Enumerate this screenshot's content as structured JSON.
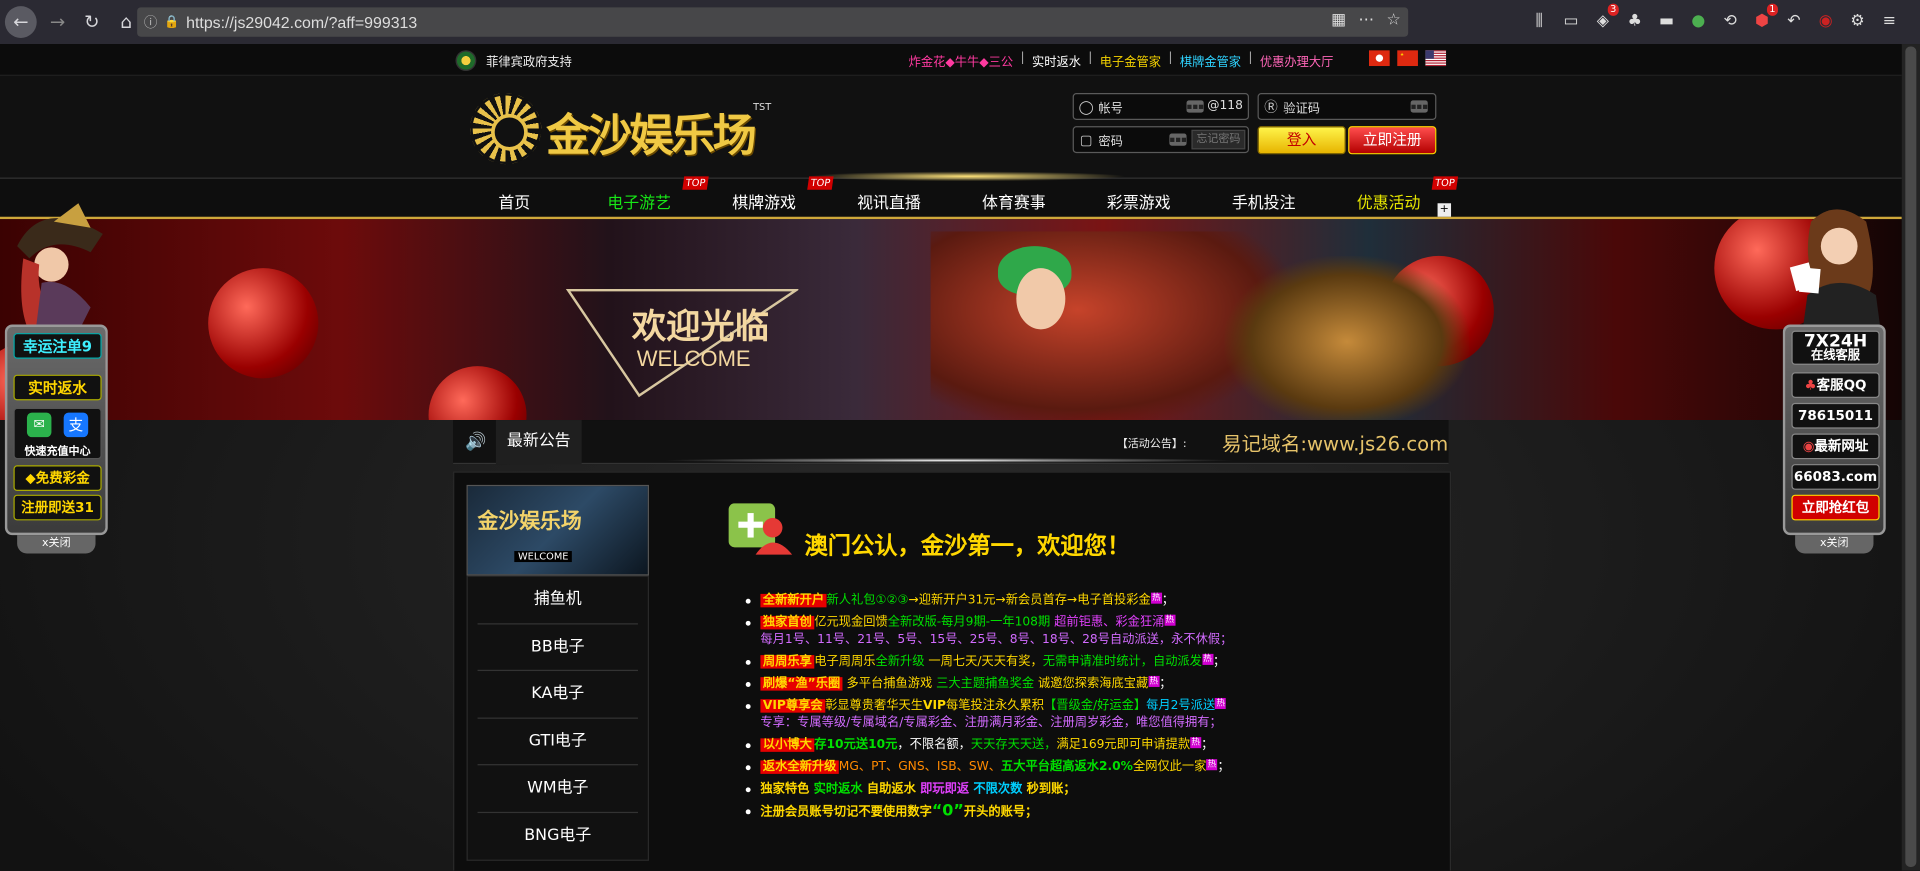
{
  "browser": {
    "url": "https://js29042.com/?aff=999313",
    "badges": {
      "ext1": "3",
      "ext2": "1"
    }
  },
  "topbar": {
    "gov_text": "菲律宾政府支持",
    "links": [
      {
        "label": "炸金花◆牛牛◆三公",
        "color": "#ff3aa0"
      },
      {
        "label": "实时返水",
        "color": "#ffffff"
      },
      {
        "label": "电子金管家",
        "color": "#f5d300"
      },
      {
        "label": "棋牌金管家",
        "color": "#2fd3ff"
      },
      {
        "label": "优惠办理大厅",
        "color": "#ff66b8"
      }
    ]
  },
  "logo": {
    "name": "金沙娱乐场",
    "tst": "TST"
  },
  "login": {
    "user_placeholder": "帐号",
    "user_suffix": "@118",
    "pass_placeholder": "密码",
    "remember": "忘记密码",
    "captcha_placeholder": "验证码",
    "login_btn": "登入",
    "register_btn": "立即注册"
  },
  "nav": {
    "items": [
      {
        "label": "首页",
        "color": "#ffffff"
      },
      {
        "label": "电子游艺",
        "color": "#17e617"
      },
      {
        "label": "棋牌游戏",
        "color": "#ffffff"
      },
      {
        "label": "视讯直播",
        "color": "#ffffff"
      },
      {
        "label": "体育赛事",
        "color": "#ffffff"
      },
      {
        "label": "彩票游戏",
        "color": "#ffffff"
      },
      {
        "label": "手机投注",
        "color": "#ffffff"
      },
      {
        "label": "优惠活动",
        "color": "#e6e600"
      }
    ],
    "tag": "TOP",
    "plus": "+"
  },
  "banner": {
    "cn": "欢迎光临",
    "en": "WELCOME"
  },
  "notice": {
    "title": "最新公告",
    "activity": "【活动公告】:",
    "domain": "易记域名:www.js26.com"
  },
  "side": {
    "img_title": "金沙娱乐场",
    "img_welcome": "WELCOME",
    "menu": [
      "捕鱼机",
      "BB电子",
      "KA电子",
      "GTI电子",
      "WM电子",
      "BNG电子"
    ]
  },
  "main": {
    "headline": "澳门公认，金沙第一，欢迎您！",
    "hot": "热",
    "items": {
      "i1": {
        "tag": "全新新开户",
        "a": "新人礼包①②③",
        "b": "→迎新开户31元→新会员首存→电子首投彩金",
        "end": "；"
      },
      "i2": {
        "tag": "独家首创",
        "a": "亿元现金回馈",
        "b": "全新改版-每月9期-一年108期",
        "c": " 超前钜惠、彩金狂涌",
        "sub": "每月1号、11号、21号、5号、15号、25号、8号、18号、28号自动派送，永不休假；"
      },
      "i3": {
        "tag": "周周乐享",
        "a": "电子周周乐",
        "b": "全新升级",
        "c": " 一周七天/天天有奖，",
        "d": "无需申请准时统计，自动派发",
        "end": "；"
      },
      "i4": {
        "tag": "刷爆“渔”乐圈",
        "a": " 多平台捕鱼游戏 ",
        "b": " 三大主题捕鱼奖金 ",
        "c": " 诚邀您探索海底宝藏",
        "end": "；"
      },
      "i5": {
        "tag": "VIP尊享会",
        "a": "彰显尊贵奢华天生",
        "b": "VIP",
        "c": "每笔投注永久累积",
        "d": "【晋级金/好运金】",
        "e": "每月2号派送",
        "sub": "专享：专属等级/专属域名/专属彩金、注册满月彩金、注册周岁彩金，唯您值得拥有；"
      },
      "i6": {
        "tag": "以小博大",
        "a": "存10元送10元",
        "b": "，不限名额，",
        "c": "天天存天天送，",
        "d": "满足169元即可申请提款",
        "end": "；"
      },
      "i7": {
        "tag": "返水全新升级",
        "a": "MG、PT、GNS、ISB、SW、",
        "b": "五大平台超高返水2.0%",
        "c": "全网仅此一家",
        "end": "；"
      },
      "i8": {
        "a": "独家特色 ",
        "b": "实时返水",
        "c": " 自助返水 ",
        "d": "即玩即返",
        "e": " 不限次数",
        "f": " 秒到账；"
      },
      "i9": {
        "a": "注册会员账号切记不要使用数字",
        "b": "“0”",
        "c": "开头的账号；"
      }
    }
  },
  "float_left": {
    "items": [
      "幸运注单9",
      "实时返水",
      "快速充值中心",
      "免费彩金",
      "注册即送31"
    ],
    "close": "x关闭"
  },
  "float_right": {
    "items": [
      "7X24H",
      "在线客服",
      "客服QQ",
      "78615011",
      "最新网址",
      "66083.com",
      "立即抢红包"
    ],
    "close": "x关闭"
  }
}
